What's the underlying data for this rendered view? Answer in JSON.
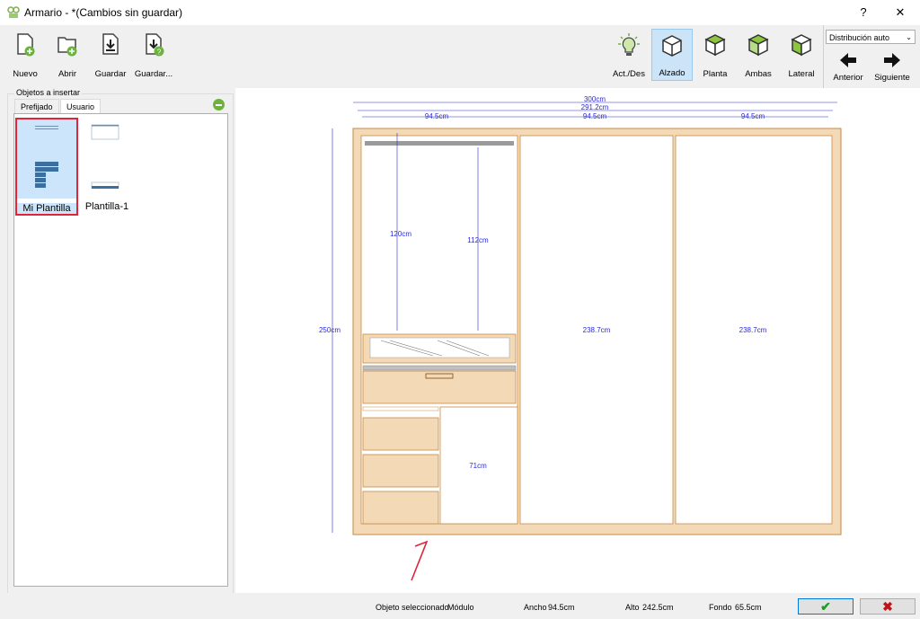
{
  "window": {
    "title": "Armario -  *(Cambios sin guardar)",
    "help": "?",
    "close": "✕"
  },
  "toolbar": {
    "left": [
      {
        "label": "Nuevo"
      },
      {
        "label": "Abrir"
      },
      {
        "label": "Guardar"
      },
      {
        "label": "Guardar..."
      }
    ],
    "views": [
      {
        "label": "Act./Des",
        "active": false
      },
      {
        "label": "Alzado",
        "active": true
      },
      {
        "label": "Planta",
        "active": false
      },
      {
        "label": "Ambas",
        "active": false
      },
      {
        "label": "Lateral",
        "active": false
      }
    ],
    "distribution": {
      "value": "Distribución auto"
    },
    "prev": "Anterior",
    "next": "Siguiente"
  },
  "panel": {
    "title": "Objetos a insertar",
    "tabs": [
      "Prefijado",
      "Usuario"
    ],
    "active_tab": "Usuario",
    "templates": [
      {
        "name": "Mi Plantilla",
        "selected": true
      },
      {
        "name": "Plantilla-1",
        "selected": false
      }
    ]
  },
  "drawing": {
    "dims": {
      "total_width": "300cm",
      "inner_width": "291.2cm",
      "module_widths": [
        "94.5cm",
        "94.5cm",
        "94.5cm"
      ],
      "height": "250cm",
      "hang_120": "120cm",
      "hang_112": "112cm",
      "door_2": "238.7cm",
      "door_3": "238.7cm",
      "lower": "71cm"
    }
  },
  "status": {
    "selected_label": "Objeto seleccionado",
    "selected_value": "Módulo",
    "width_label": "Ancho",
    "width_value": "94.5cm",
    "height_label": "Alto",
    "height_value": "242.5cm",
    "depth_label": "Fondo",
    "depth_value": "65.5cm",
    "ok": "✔",
    "cancel": "✖"
  },
  "colors": {
    "wood": "#f3d9b6",
    "wood_edge": "#c68a47",
    "dimension": "#2a2ad8",
    "selection": "#e0243a",
    "accent_active": "#cce4f7"
  }
}
